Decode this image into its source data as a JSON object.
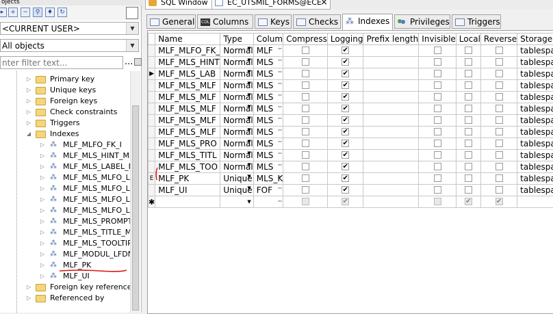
{
  "left_panel": {
    "title_fragment": "ojects",
    "user_combo": "<CURRENT USER>",
    "objects_combo": "All objects",
    "filter_placeholder": "nter filter text...",
    "filter_more": "...",
    "tree": [
      {
        "label": "Primary key",
        "type": "folder",
        "level": 1
      },
      {
        "label": "Unique keys",
        "type": "folder",
        "level": 1
      },
      {
        "label": "Foreign keys",
        "type": "folder",
        "level": 1
      },
      {
        "label": "Check constraints",
        "type": "folder",
        "level": 1
      },
      {
        "label": "Triggers",
        "type": "folder",
        "level": 1
      },
      {
        "label": "Indexes",
        "type": "folder-open",
        "level": 1
      },
      {
        "label": "MLF_MLFO_FK_I",
        "type": "index",
        "level": 2
      },
      {
        "label": "MLF_MLS_HINT_ML",
        "type": "index",
        "level": 2
      },
      {
        "label": "MLF_MLS_LABEL_M",
        "type": "index",
        "level": 2
      },
      {
        "label": "MLF_MLS_MLFO_LF",
        "type": "index",
        "level": 2
      },
      {
        "label": "MLF_MLS_MLFO_LF",
        "type": "index",
        "level": 2
      },
      {
        "label": "MLF_MLS_MLFO_LF",
        "type": "index",
        "level": 2
      },
      {
        "label": "MLF_MLS_MLFO_LF",
        "type": "index",
        "level": 2
      },
      {
        "label": "MLF_MLS_PROMPT",
        "type": "index",
        "level": 2
      },
      {
        "label": "MLF_MLS_TITLE_ML",
        "type": "index",
        "level": 2
      },
      {
        "label": "MLF_MLS_TOOLTIP",
        "type": "index",
        "level": 2
      },
      {
        "label": "MLF_MODUL_LFDN",
        "type": "index",
        "level": 2
      },
      {
        "label": "MLF_PK",
        "type": "index",
        "level": 2
      },
      {
        "label": "MLF_UI",
        "type": "index",
        "level": 2
      },
      {
        "label": "Foreign key references",
        "type": "folder",
        "level": 1
      },
      {
        "label": "Referenced by",
        "type": "folder",
        "level": 1
      }
    ]
  },
  "doc_tabs": [
    {
      "label": "SQL Window"
    },
    {
      "label": "EC_UTSMIL_FORMS@ECE"
    }
  ],
  "sub_tabs": [
    {
      "label": "General",
      "active": false
    },
    {
      "label": "Columns",
      "active": false
    },
    {
      "label": "Keys",
      "active": false
    },
    {
      "label": "Checks",
      "active": false
    },
    {
      "label": "Indexes",
      "active": true
    },
    {
      "label": "Privileges",
      "active": false
    },
    {
      "label": "Triggers",
      "active": false
    }
  ],
  "grid": {
    "columns": [
      "Name",
      "Type",
      "Colum",
      "Compress",
      "Logging",
      "Prefix length",
      "Invisible",
      "Local",
      "Reverse",
      "Storage"
    ],
    "rows": [
      {
        "indicator": "",
        "name": "MLF_MLFO_FK_",
        "type": "Normal",
        "col": "MLF",
        "compress": false,
        "logging": true,
        "prefix": "",
        "invisible": false,
        "local": false,
        "reverse": false,
        "storage": "tablespace"
      },
      {
        "indicator": "",
        "name": "MLF_MLS_HINT",
        "type": "Normal",
        "col": "MLS",
        "compress": false,
        "logging": true,
        "prefix": "",
        "invisible": false,
        "local": false,
        "reverse": false,
        "storage": "tablespace"
      },
      {
        "indicator": "▶",
        "name": "MLF_MLS_LAB",
        "type": "Normal",
        "col": "MLS",
        "compress": false,
        "logging": true,
        "prefix": "",
        "invisible": false,
        "local": false,
        "reverse": false,
        "storage": "tablespace"
      },
      {
        "indicator": "",
        "name": "MLF_MLS_MLF",
        "type": "Normal",
        "col": "MLS",
        "compress": false,
        "logging": true,
        "prefix": "",
        "invisible": false,
        "local": false,
        "reverse": false,
        "storage": "tablespace"
      },
      {
        "indicator": "",
        "name": "MLF_MLS_MLF",
        "type": "Normal",
        "col": "MLS",
        "compress": false,
        "logging": true,
        "prefix": "",
        "invisible": false,
        "local": false,
        "reverse": false,
        "storage": "tablespace"
      },
      {
        "indicator": "",
        "name": "MLF_MLS_MLF",
        "type": "Normal",
        "col": "MLS",
        "compress": false,
        "logging": true,
        "prefix": "",
        "invisible": false,
        "local": false,
        "reverse": false,
        "storage": "tablespace"
      },
      {
        "indicator": "",
        "name": "MLF_MLS_MLF",
        "type": "Normal",
        "col": "MLS",
        "compress": false,
        "logging": true,
        "prefix": "",
        "invisible": false,
        "local": false,
        "reverse": false,
        "storage": "tablespace"
      },
      {
        "indicator": "",
        "name": "MLF_MLS_MLF",
        "type": "Normal",
        "col": "MLS",
        "compress": false,
        "logging": true,
        "prefix": "",
        "invisible": false,
        "local": false,
        "reverse": false,
        "storage": "tablespace"
      },
      {
        "indicator": "",
        "name": "MLF_MLS_PRO",
        "type": "Normal",
        "col": "MLS",
        "compress": false,
        "logging": true,
        "prefix": "",
        "invisible": false,
        "local": false,
        "reverse": false,
        "storage": "tablespace"
      },
      {
        "indicator": "",
        "name": "MLF_MLS_TITL",
        "type": "Normal",
        "col": "MLS",
        "compress": false,
        "logging": true,
        "prefix": "",
        "invisible": false,
        "local": false,
        "reverse": false,
        "storage": "tablespace"
      },
      {
        "indicator": "",
        "name": "MLF_MLS_TOO",
        "type": "Normal",
        "col": "MLS",
        "compress": false,
        "logging": true,
        "prefix": "",
        "invisible": false,
        "local": false,
        "reverse": false,
        "storage": "tablespace"
      },
      {
        "indicator": "E",
        "name": "MLF_PK",
        "type": "Unique",
        "col": "MLS_K",
        "compress": false,
        "logging": true,
        "prefix": "",
        "invisible": false,
        "local": false,
        "reverse": false,
        "storage": "tablespace"
      },
      {
        "indicator": "",
        "name": "MLF_UI",
        "type": "Unique",
        "col": "FOF",
        "compress": false,
        "logging": true,
        "prefix": "",
        "invisible": false,
        "local": false,
        "reverse": false,
        "storage": "tablespace"
      }
    ],
    "new_row_indicator": "✱"
  }
}
